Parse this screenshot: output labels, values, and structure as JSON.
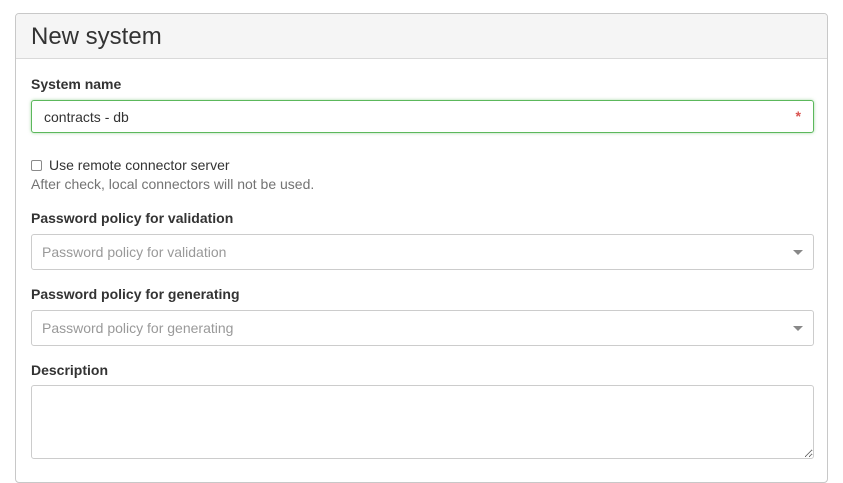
{
  "panel": {
    "title": "New system"
  },
  "form": {
    "system_name": {
      "label": "System name",
      "value": "contracts - db",
      "required_mark": "*"
    },
    "remote_connector": {
      "label": "Use remote connector server",
      "checked": false,
      "help": "After check, local connectors will not be used."
    },
    "password_policy_validation": {
      "label": "Password policy for validation",
      "placeholder": "Password policy for validation"
    },
    "password_policy_generating": {
      "label": "Password policy for generating",
      "placeholder": "Password policy for generating"
    },
    "description": {
      "label": "Description",
      "value": ""
    }
  },
  "colors": {
    "focus_border": "#5cb85c",
    "required": "#d9534f",
    "placeholder": "#999999"
  }
}
